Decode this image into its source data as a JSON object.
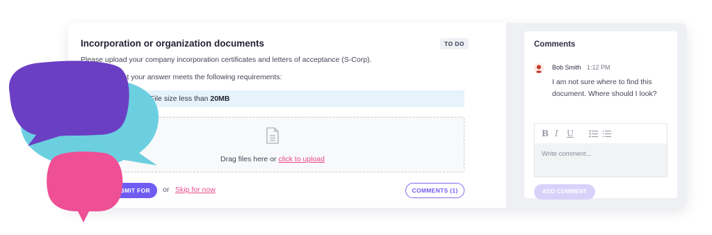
{
  "task": {
    "title": "Incorporation or organization documents",
    "status_badge": "TO DO",
    "description": "Please upload your company incorporation certificates and letters of acceptance (S-Corp).",
    "requirements_intro": "Make sure that your answer meets the following requirements:",
    "requirement_prefix": "File size less than",
    "requirement_value": "20MB",
    "dropzone": {
      "icon": "file-icon",
      "text": "Drag files here or",
      "link": "click to upload"
    },
    "submit_label": "SUBMIT FOR REVIEW",
    "or_text": "or",
    "skip_label": "Skip for now",
    "comments_button": "COMMENTS (1)"
  },
  "comments": {
    "title": "Comments",
    "items": [
      {
        "author": "Bob Smith",
        "time": "1:12 PM",
        "text": "I am not sure where to find this document. Where should I look?"
      }
    ],
    "editor": {
      "bold": "B",
      "italic": "I",
      "underline": "U",
      "placeholder": "Write comment..."
    },
    "add_label": "ADD COMMENT"
  },
  "colors": {
    "accent": "#6f5cf2",
    "link": "#e84a8a",
    "bubble_purple": "#6b3fc4",
    "bubble_cyan": "#6ccfe0",
    "bubble_pink": "#ee4f95"
  }
}
